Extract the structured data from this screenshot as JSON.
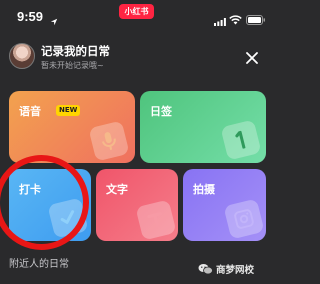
{
  "status_bar": {
    "time": "9:59",
    "app_badge": "小红书",
    "icons": [
      "location-arrow-icon",
      "signal-icon",
      "wifi-icon",
      "battery-icon"
    ]
  },
  "header": {
    "title": "记录我的日常",
    "subtitle": "暂未开始记录哦~",
    "close_icon": "close-icon"
  },
  "cards": {
    "voice": {
      "label": "语音",
      "badge": "NEW",
      "icon": "microphone-icon"
    },
    "daily": {
      "label": "日签",
      "icon": "number-one-icon"
    },
    "checkin": {
      "label": "打卡",
      "icon": "checkmark-icon"
    },
    "text": {
      "label": "文字",
      "icon": "letter-t-icon"
    },
    "photo": {
      "label": "拍摄",
      "icon": "camera-icon"
    }
  },
  "section": {
    "nearby_title": "附近人的日常"
  },
  "watermark": {
    "text": "商梦网校",
    "icon": "wechat-icon"
  },
  "colors": {
    "background": "#2a2a2c",
    "brand_red": "#ff2442",
    "voice": "#f2a24e",
    "daily": "#4fc47d",
    "checkin": "#59b6f4",
    "text": "#f0556a",
    "photo": "#8873f3",
    "annotation": "#e81616"
  }
}
